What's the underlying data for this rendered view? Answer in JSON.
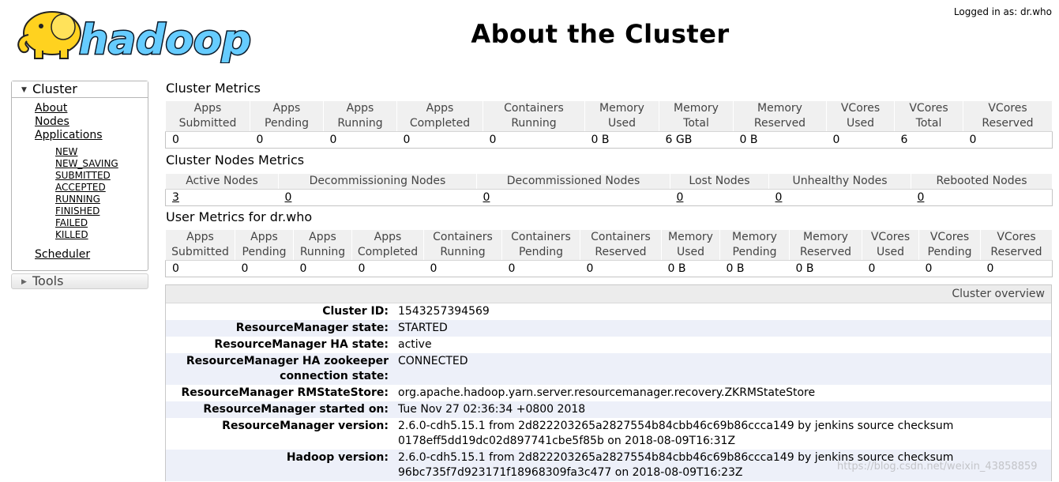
{
  "header": {
    "logo_text": "hadoop",
    "title": "About the Cluster",
    "logged_in": "Logged in as: dr.who"
  },
  "nav": {
    "cluster_label": "Cluster",
    "links": [
      "About",
      "Nodes",
      "Applications"
    ],
    "app_states": [
      "NEW",
      "NEW_SAVING",
      "SUBMITTED",
      "ACCEPTED",
      "RUNNING",
      "FINISHED",
      "FAILED",
      "KILLED"
    ],
    "scheduler": "Scheduler",
    "tools_label": "Tools"
  },
  "cluster_metrics": {
    "title": "Cluster Metrics",
    "headers": [
      [
        "Apps",
        "Submitted"
      ],
      [
        "Apps",
        "Pending"
      ],
      [
        "Apps",
        "Running"
      ],
      [
        "Apps",
        "Completed"
      ],
      [
        "Containers",
        "Running"
      ],
      [
        "Memory",
        "Used"
      ],
      [
        "Memory",
        "Total"
      ],
      [
        "Memory",
        "Reserved"
      ],
      [
        "VCores",
        "Used"
      ],
      [
        "VCores",
        "Total"
      ],
      [
        "VCores",
        "Reserved"
      ]
    ],
    "values": [
      "0",
      "0",
      "0",
      "0",
      "0",
      "0 B",
      "6 GB",
      "0 B",
      "0",
      "6",
      "0"
    ]
  },
  "node_metrics": {
    "title": "Cluster Nodes Metrics",
    "headers": [
      "Active Nodes",
      "Decommissioning Nodes",
      "Decommissioned Nodes",
      "Lost Nodes",
      "Unhealthy Nodes",
      "Rebooted Nodes"
    ],
    "values": [
      "3",
      "0",
      "0",
      "0",
      "0",
      "0"
    ]
  },
  "user_metrics": {
    "title": "User Metrics for dr.who",
    "headers": [
      [
        "Apps",
        "Submitted"
      ],
      [
        "Apps",
        "Pending"
      ],
      [
        "Apps",
        "Running"
      ],
      [
        "Apps",
        "Completed"
      ],
      [
        "Containers",
        "Running"
      ],
      [
        "Containers",
        "Pending"
      ],
      [
        "Containers",
        "Reserved"
      ],
      [
        "Memory",
        "Used"
      ],
      [
        "Memory",
        "Pending"
      ],
      [
        "Memory",
        "Reserved"
      ],
      [
        "VCores",
        "Used"
      ],
      [
        "VCores",
        "Pending"
      ],
      [
        "VCores",
        "Reserved"
      ]
    ],
    "values": [
      "0",
      "0",
      "0",
      "0",
      "0",
      "0",
      "0",
      "0 B",
      "0 B",
      "0 B",
      "0",
      "0",
      "0"
    ]
  },
  "overview": {
    "header": "Cluster overview",
    "rows": [
      {
        "label": "Cluster ID:",
        "value": "1543257394569"
      },
      {
        "label": "ResourceManager state:",
        "value": "STARTED"
      },
      {
        "label": "ResourceManager HA state:",
        "value": "active"
      },
      {
        "label": "ResourceManager HA zookeeper connection state:",
        "value": "CONNECTED"
      },
      {
        "label": "ResourceManager RMStateStore:",
        "value": "org.apache.hadoop.yarn.server.resourcemanager.recovery.ZKRMStateStore"
      },
      {
        "label": "ResourceManager started on:",
        "value": "Tue Nov 27 02:36:34 +0800 2018"
      },
      {
        "label": "ResourceManager version:",
        "value": "2.6.0-cdh5.15.1 from 2d822203265a2827554b84cbb46c69b86ccca149 by jenkins source checksum 0178eff5dd19dc02d897741cbe5f85b on 2018-08-09T16:31Z"
      },
      {
        "label": "Hadoop version:",
        "value": "2.6.0-cdh5.15.1 from 2d822203265a2827554b84cbb46c69b86ccca149 by jenkins source checksum 96bc735f7d923171f18968309fa3c477 on 2018-08-09T16:23Z"
      }
    ]
  },
  "watermark": "https://blog.csdn.net/weixin_43858859",
  "colors": {
    "logo_yellow": "#ffd21f",
    "logo_blue": "#66ccff",
    "header_bg": "#f0f0f0",
    "row_alt": "#edf0f9"
  }
}
